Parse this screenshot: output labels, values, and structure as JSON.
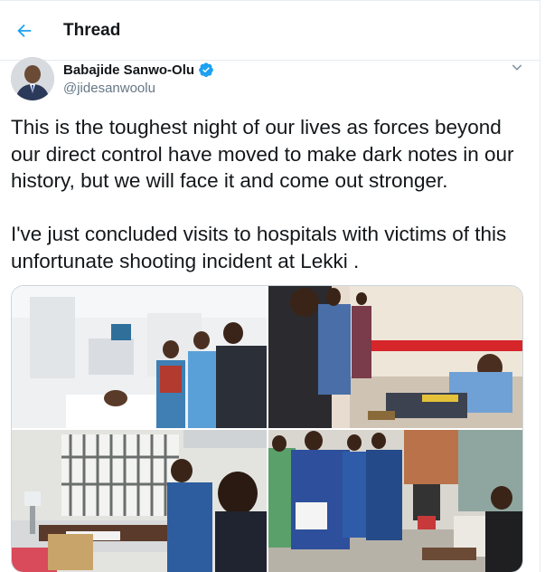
{
  "header": {
    "title": "Thread",
    "back_icon": "arrow-left-icon"
  },
  "author": {
    "name": "Babajide Sanwo-Olu",
    "handle": "@jidesanwoolu",
    "verified": true,
    "verified_icon": "verified-badge-icon"
  },
  "tweet": {
    "paragraph1": "This is the toughest night of our lives as forces beyond our direct control have moved to make dark notes in our history, but we will face it and come out stronger.",
    "paragraph2": "I've just concluded visits to hospitals with victims of this unfortunate shooting incident at Lekki ."
  },
  "media": {
    "count": 4,
    "images": [
      "hospital-ward-photo",
      "injured-man-on-bed-photo",
      "patient-on-stretcher-photo",
      "hospital-corridor-photo"
    ]
  },
  "colors": {
    "accent": "#1da1f2",
    "text": "#14171a",
    "muted": "#657786",
    "border": "#e6ecf0"
  }
}
